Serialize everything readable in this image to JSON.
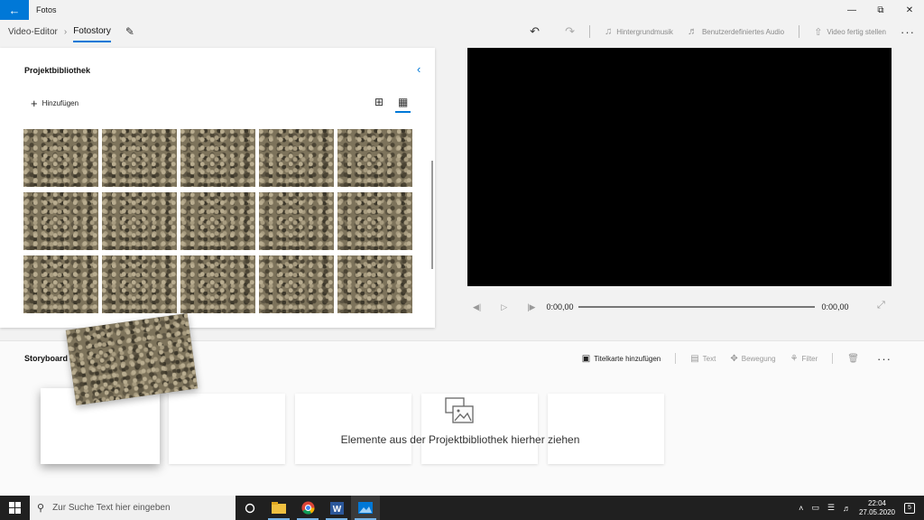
{
  "window": {
    "app_title": "Fotos",
    "back_icon": "arrow-left-icon",
    "accent": "#0078d7"
  },
  "breadcrumb": {
    "parent": "Video-Editor",
    "current": "Fotostory"
  },
  "toolbar": {
    "background_music": "Hintergrundmusik",
    "custom_audio": "Benutzerdefiniertes Audio",
    "finish_video": "Video fertig stellen"
  },
  "library": {
    "title": "Projektbibliothek",
    "add_label": "Hinzufügen",
    "thumbnail_count": 15
  },
  "player": {
    "current_time": "0:00,00",
    "total_time": "0:00,00",
    "progress": 0
  },
  "storyboard": {
    "title": "Storyboard",
    "add_title_card": "Titelkarte hinzufügen",
    "text": "Text",
    "motion": "Bewegung",
    "filter": "Filter",
    "drop_hint": "Elemente aus der Projektbibliothek hierher ziehen"
  },
  "taskbar": {
    "search_placeholder": "Zur Suche Text hier eingeben",
    "time": "22:04",
    "date": "27.05.2020",
    "notification_count": "5"
  }
}
